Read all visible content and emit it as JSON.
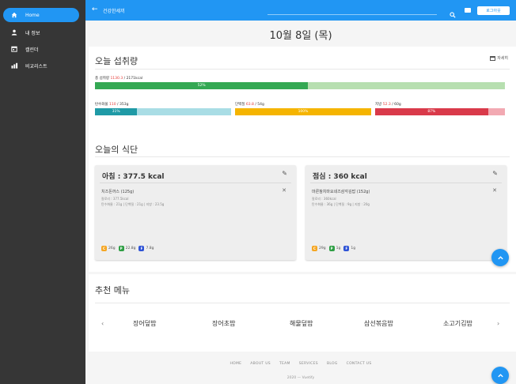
{
  "sidebar": {
    "items": [
      {
        "label": "Home",
        "icon": "home-icon",
        "active": true
      },
      {
        "label": "내 정보",
        "icon": "person-icon",
        "active": false
      },
      {
        "label": "캘린더",
        "icon": "calendar-icon",
        "active": false
      },
      {
        "label": "비교리스트",
        "icon": "chart-icon",
        "active": false
      }
    ]
  },
  "appbar": {
    "back": "←",
    "title": "건강한세끼",
    "logout": "로그아웃"
  },
  "page": {
    "date": "10월 8일 (목)"
  },
  "intake": {
    "title": "오늘 섭취량",
    "calendar_link": "자세히",
    "total": {
      "label": "총 섭취량",
      "value": "1130.3",
      "goal": "/ 2171kcal",
      "percent": 0.52,
      "percent_label": "52%"
    },
    "carbs": {
      "label": "탄수화물",
      "value": "110",
      "goal": "/ 353g",
      "percent": 0.31,
      "percent_label": "31%"
    },
    "protein": {
      "label": "단백질",
      "value": "63.8",
      "goal": "/ 54g",
      "percent": 1.0,
      "percent_label": "100%"
    },
    "fat": {
      "label": "지방",
      "value": "52.3",
      "goal": "/ 60g",
      "percent": 0.87,
      "percent_label": "87%"
    }
  },
  "meals": {
    "title": "오늘의 식단",
    "cards": [
      {
        "title": "아침 : 377.5 kcal",
        "food": "치즈돈까스 (125g)",
        "kcal_line": "칼로리 : 377.5kcal",
        "macro_line": "탄수화물 : 21g | 단백질 : 21g | 지방 : 23.5g",
        "chips": [
          {
            "letter": "C",
            "value": "26g"
          },
          {
            "letter": "P",
            "value": "22.8g"
          },
          {
            "letter": "F",
            "value": "7.8g"
          }
        ]
      },
      {
        "title": "점심 : 360 kcal",
        "food": "마른참치마요네즈삼각김밥 (152g)",
        "kcal_line": "칼로리 : 360kcal",
        "macro_line": "탄수화물 : 36g | 단백질 : 9g | 지방 : 20g",
        "chips": [
          {
            "letter": "C",
            "value": "29g"
          },
          {
            "letter": "P",
            "value": "1g"
          },
          {
            "letter": "F",
            "value": "1g"
          }
        ]
      }
    ]
  },
  "recommend": {
    "title": "추천 메뉴",
    "prev": "‹",
    "next": "›",
    "items": [
      "장어덮밥",
      "장어초밥",
      "해물덮밥",
      "삼선볶음밥",
      "소고기김밥"
    ]
  },
  "footer": {
    "links": [
      "HOME",
      "ABOUT US",
      "TEAM",
      "SERVICES",
      "BLOG",
      "CONTACT US"
    ],
    "copyright": "2020 — Vuetify"
  },
  "colors": {
    "primary": "#2196f3",
    "total_fill": "#34a853",
    "total_track": "#b7dfb0",
    "carbs_fill": "#1f9aa6",
    "carbs_track": "#a9dde5",
    "protein_fill": "#f5b400",
    "protein_track": "#f8d97a",
    "fat_fill": "#d93a4a",
    "fat_track": "#f2a9b2"
  }
}
